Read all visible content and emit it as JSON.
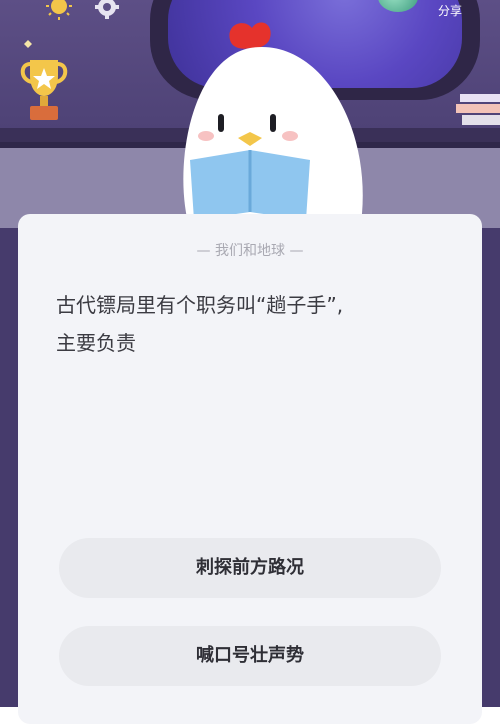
{
  "header": {
    "share_label": "分享"
  },
  "card": {
    "category": "— 我们和地球 —",
    "question_line1": "古代镖局里有个职务叫“趟子手”,",
    "question_line2": "主要负责"
  },
  "options": [
    {
      "label": "刺探前方路况"
    },
    {
      "label": "喊口号壮声势"
    }
  ],
  "icons": {
    "sun": "sun-icon",
    "gear": "gear-icon",
    "trophy": "trophy-icon",
    "books": "books-icon",
    "mascot": "chicken-mascot"
  },
  "colors": {
    "background": "#4f4377",
    "card": "#f3f4f8",
    "option": "#e9eaee",
    "text": "#3b3b42"
  }
}
